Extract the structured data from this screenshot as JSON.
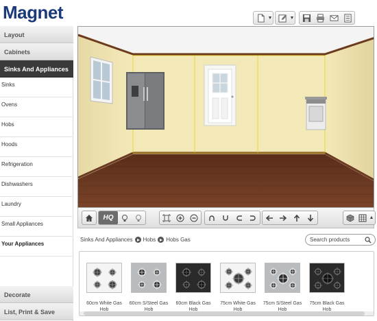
{
  "header": {
    "logo": "Magnet",
    "toolbar": [
      {
        "name": "new-document-icon"
      },
      {
        "name": "edit-icon"
      },
      {
        "name": "save-icon"
      },
      {
        "name": "print-icon"
      },
      {
        "name": "email-icon"
      },
      {
        "name": "list-icon"
      }
    ]
  },
  "sidebar": {
    "categories": [
      {
        "label": "Layout"
      },
      {
        "label": "Cabinets"
      },
      {
        "label": "Sinks And Appliances",
        "active": true
      }
    ],
    "items": [
      {
        "label": "Sinks"
      },
      {
        "label": "Ovens"
      },
      {
        "label": "Hobs"
      },
      {
        "label": "Hoods"
      },
      {
        "label": "Refrigeration"
      },
      {
        "label": "Dishwashers"
      },
      {
        "label": "Laundry"
      },
      {
        "label": "Small Appliances"
      },
      {
        "label": "Your Appliances",
        "bold": true
      }
    ],
    "bottom_categories": [
      {
        "label": "Decorate"
      },
      {
        "label": "List, Print & Save"
      }
    ]
  },
  "viewport_toolbar": {
    "hq_label": "HQ",
    "icons": [
      "home-icon",
      "light-bulb-icon",
      "light-bulb-off-icon",
      "fit-view-icon",
      "zoom-in-icon",
      "zoom-out-icon",
      "rotate-left-icon",
      "rotate-down-icon",
      "rotate-up-icon",
      "rotate-right-icon",
      "pan-left-icon",
      "pan-right-icon",
      "pan-up-icon",
      "pan-down-icon",
      "view-mode-icon",
      "grid-icon"
    ]
  },
  "breadcrumb": [
    "Sinks And Appliances",
    "Hobs",
    "Hobs Gas"
  ],
  "search": {
    "placeholder": "Search products"
  },
  "products": [
    {
      "name": "60cm White Gas Hob",
      "finish": "white",
      "burners": 4
    },
    {
      "name": "60cm S/Steel Gas Hob",
      "finish": "steel",
      "burners": 4
    },
    {
      "name": "60cm Black Gas Hob",
      "finish": "black",
      "burners": 4
    },
    {
      "name": "75cm White Gas Hob",
      "finish": "white",
      "burners": 5
    },
    {
      "name": "75cm S/Steel Gas Hob",
      "finish": "steel",
      "burners": 5
    },
    {
      "name": "75cm Black Gas Hob",
      "finish": "black",
      "burners": 5
    }
  ],
  "colors": {
    "logo": "#1c3a7a",
    "active_category": "#3a3a3a",
    "wall": "#f3e9b8",
    "floor": "#6b3a22",
    "ceiling": "#f7f7f7"
  }
}
